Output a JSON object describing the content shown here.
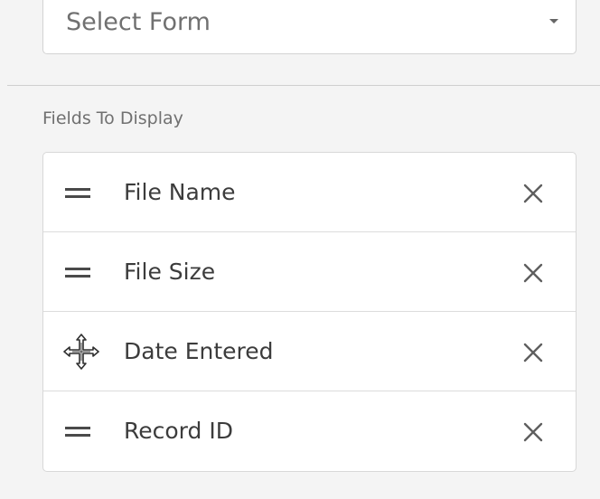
{
  "form_select": {
    "placeholder": "Select Form",
    "caret_icon": "caret-down-icon"
  },
  "fields_section": {
    "label": "Fields To Display",
    "items": [
      {
        "label": "File Name",
        "handle_icon": "drag-handle-icon",
        "remove_icon": "close-icon"
      },
      {
        "label": "File Size",
        "handle_icon": "drag-handle-icon",
        "remove_icon": "close-icon"
      },
      {
        "label": "Date Entered",
        "handle_icon": "move-cursor-icon",
        "remove_icon": "close-icon"
      },
      {
        "label": "Record ID",
        "handle_icon": "drag-handle-icon",
        "remove_icon": "close-icon"
      }
    ]
  },
  "colors": {
    "background": "#f4f4f4",
    "panel": "#ffffff",
    "border": "#d8d8d8",
    "text": "#3c3c3c",
    "muted_text": "#707070"
  }
}
